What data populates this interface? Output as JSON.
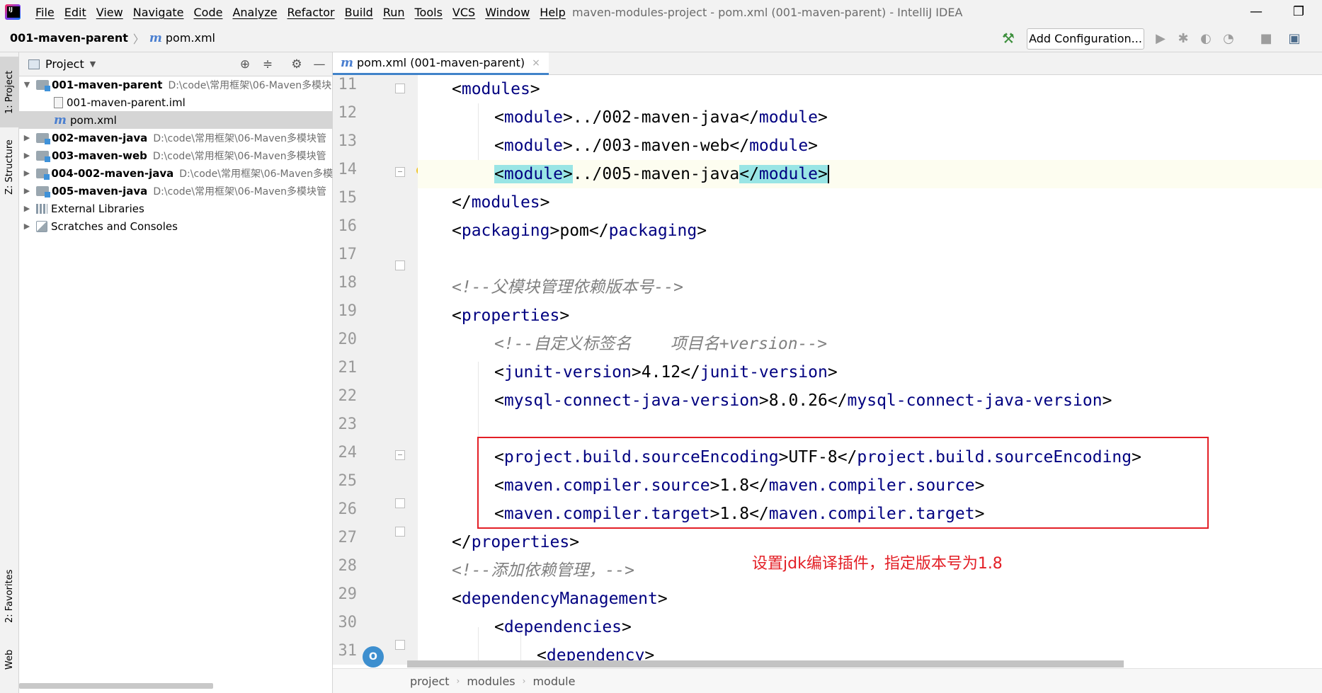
{
  "menu": [
    "File",
    "Edit",
    "View",
    "Navigate",
    "Code",
    "Analyze",
    "Refactor",
    "Build",
    "Run",
    "Tools",
    "VCS",
    "Window",
    "Help"
  ],
  "window_title": "maven-modules-project - pom.xml (001-maven-parent) - IntelliJ IDEA",
  "window_controls": {
    "minimize": "—",
    "restore": "❐"
  },
  "navbar": {
    "root": "001-maven-parent",
    "separator": "〉",
    "file_icon": "m",
    "file": "pom.xml",
    "add_configuration": "Add Configuration..."
  },
  "toolbar_icons": [
    "build-hammer-icon",
    "run-icon",
    "debug-icon",
    "coverage-icon",
    "profile-icon",
    "stop-icon",
    "project-structure-icon"
  ],
  "left_stripe": {
    "project": "1: Project",
    "structure": "Z: Structure",
    "favorites": "2: Favorites",
    "web": "Web"
  },
  "project_panel": {
    "title": "Project",
    "tree": [
      {
        "kind": "module",
        "name": "001-maven-parent",
        "path": "D:\\code\\常用框架\\06-Maven多模块",
        "expanded": true
      },
      {
        "kind": "iml",
        "name": "001-maven-parent.iml"
      },
      {
        "kind": "pom",
        "name": "pom.xml",
        "selected": true
      },
      {
        "kind": "module",
        "name": "002-maven-java",
        "path": "D:\\code\\常用框架\\06-Maven多模块管"
      },
      {
        "kind": "module",
        "name": "003-maven-web",
        "path": "D:\\code\\常用框架\\06-Maven多模块管"
      },
      {
        "kind": "module",
        "name": "004-002-maven-java",
        "path": "D:\\code\\常用框架\\06-Maven多模"
      },
      {
        "kind": "module",
        "name": "005-maven-java",
        "path": "D:\\code\\常用框架\\06-Maven多模块管"
      },
      {
        "kind": "lib",
        "name": "External Libraries"
      },
      {
        "kind": "scratch",
        "name": "Scratches and Consoles"
      }
    ]
  },
  "editor": {
    "tab_label": "pom.xml (001-maven-parent)",
    "tab_close": "×",
    "lines": [
      {
        "n": "11"
      },
      {
        "n": "12"
      },
      {
        "n": "13"
      },
      {
        "n": "14"
      },
      {
        "n": "15"
      },
      {
        "n": "16"
      },
      {
        "n": "17"
      },
      {
        "n": "18"
      },
      {
        "n": "19"
      },
      {
        "n": "20"
      },
      {
        "n": "21"
      },
      {
        "n": "22"
      },
      {
        "n": "23"
      },
      {
        "n": "24"
      },
      {
        "n": "25"
      },
      {
        "n": "26"
      },
      {
        "n": "27"
      },
      {
        "n": "28"
      },
      {
        "n": "29"
      },
      {
        "n": "30"
      },
      {
        "n": "31"
      }
    ],
    "code": {
      "l11_tag": "modules",
      "l12_tag": "module",
      "l12_text": "../002-maven-java",
      "l13_tag": "module",
      "l13_text": "../003-maven-web",
      "l14_tag": "module",
      "l14_text": "../005-maven-java",
      "l15_tag": "modules",
      "l16_tag": "packaging",
      "l16_text": "pom",
      "l18_comment": "<!--父模块管理依赖版本号-->",
      "l19_tag": "properties",
      "l20_comment": "<!--自定义标签名    项目名+version-->",
      "l21_tag": "junit-version",
      "l21_text": "4.12",
      "l22_tag": "mysql-connect-java-version",
      "l22_text": "8.0.26",
      "l24_tag": "project.build.sourceEncoding",
      "l24_text": "UTF-8",
      "l25_tag": "maven.compiler.source",
      "l25_text": "1.8",
      "l26_tag": "maven.compiler.target",
      "l26_text": "1.8",
      "l27_tag": "properties",
      "l28_comment": "<!--添加依赖管理，-->",
      "l29_tag": "dependencyManagement",
      "l30_tag": "dependencies",
      "l31_tag": "dependency"
    },
    "annotation": "设置jdk编译插件，指定版本号为1.8"
  },
  "breadcrumbs": [
    "project",
    "modules",
    "module"
  ],
  "colors": {
    "tag": "#000080",
    "comment": "#808080",
    "highlight": "#99e5e5",
    "annotation": "#e31f26"
  }
}
